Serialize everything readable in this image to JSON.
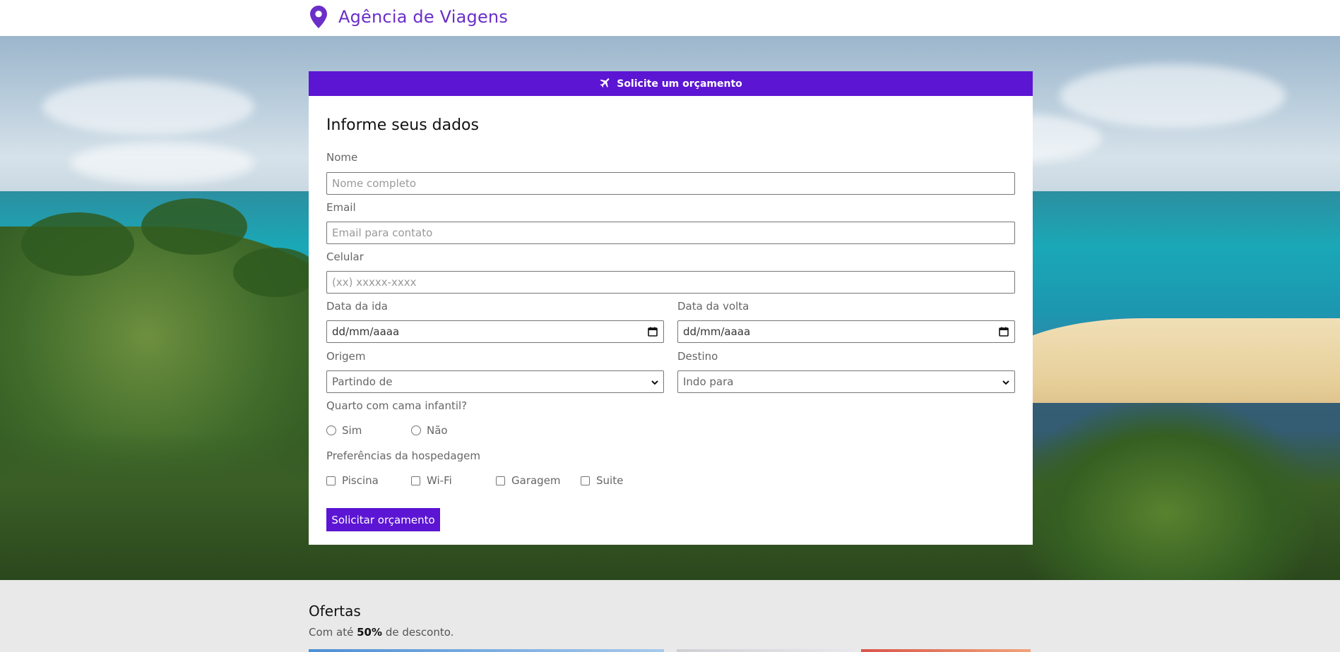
{
  "header": {
    "brand_icon": "map-pin-icon",
    "brand_title": "Agência de Viagens",
    "brand_color": "#6a2ec9"
  },
  "form": {
    "header_icon": "plane-icon",
    "header_label": "Solicite um orçamento",
    "accent_color": "#5c15d3",
    "title": "Informe seus dados",
    "nome": {
      "label": "Nome",
      "placeholder": "Nome completo"
    },
    "email": {
      "label": "Email",
      "placeholder": "Email para contato"
    },
    "celular": {
      "label": "Celular",
      "placeholder": "(xx) xxxxx-xxxx"
    },
    "data_ida": {
      "label": "Data da ida",
      "value": "dd/mm/aaaa"
    },
    "data_volta": {
      "label": "Data da volta",
      "value": "dd/mm/aaaa"
    },
    "origem": {
      "label": "Origem",
      "selected": "Partindo de"
    },
    "destino": {
      "label": "Destino",
      "selected": "Indo para"
    },
    "cama_infantil": {
      "label": "Quarto com cama infantil?",
      "options": [
        "Sim",
        "Não"
      ]
    },
    "preferencias": {
      "label": "Preferências da hospedagem",
      "options": [
        "Piscina",
        "Wi-Fi",
        "Garagem",
        "Suite"
      ]
    },
    "submit_label": "Solicitar orçamento"
  },
  "offers": {
    "title": "Ofertas",
    "subtitle_prefix": "Com até",
    "subtitle_highlight": "50%",
    "subtitle_suffix": "de desconto."
  }
}
